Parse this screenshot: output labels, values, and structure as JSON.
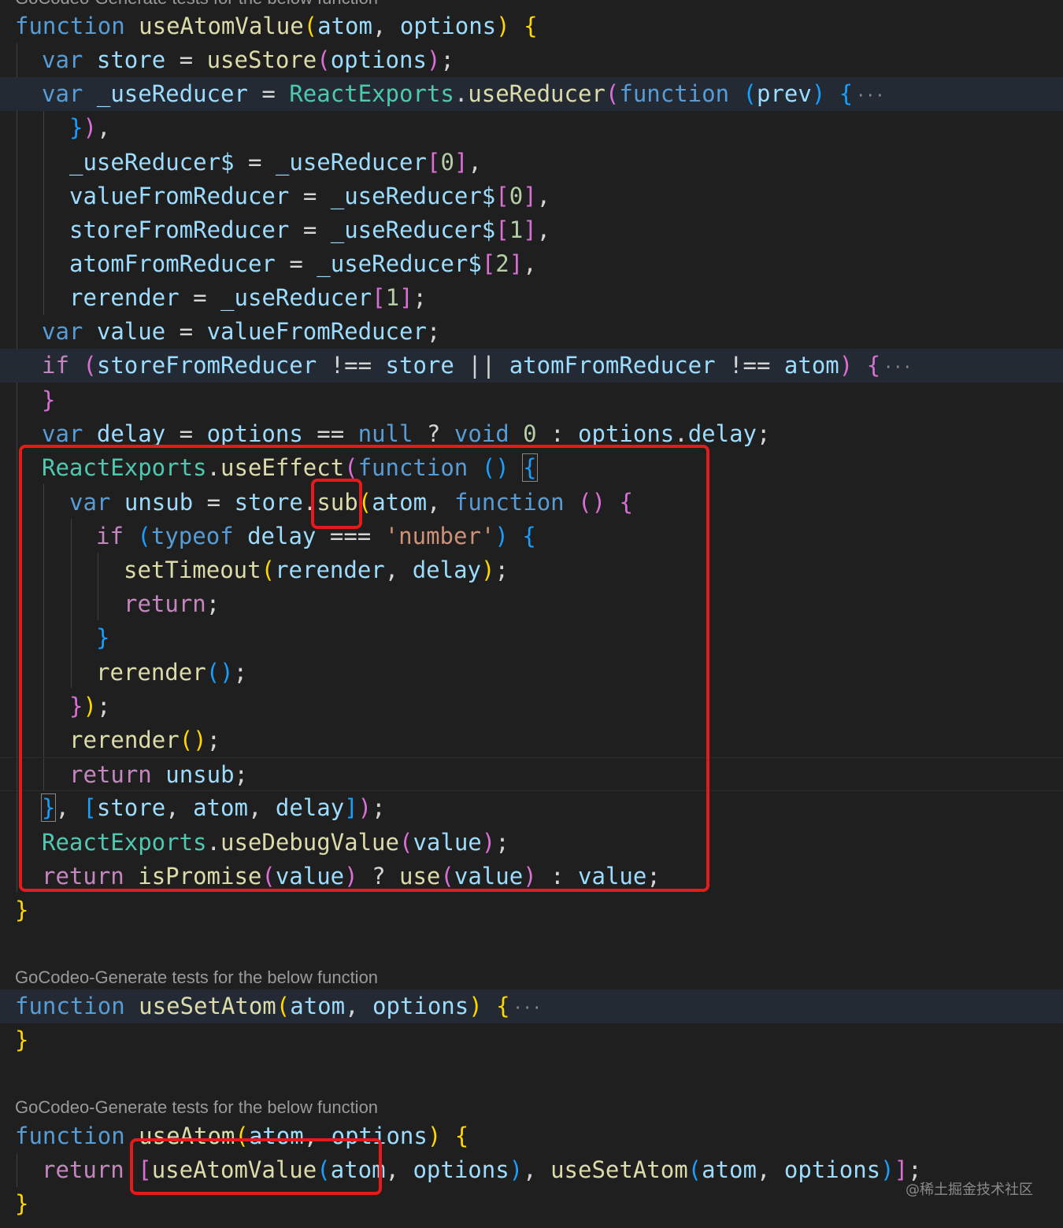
{
  "code_lens": {
    "top_partial": "GoCodeo-Generate tests for the below function",
    "use_set_atom": "GoCodeo-Generate tests for the below function",
    "use_atom": "GoCodeo-Generate tests for the below function"
  },
  "code": {
    "l1": [
      "function",
      " ",
      "useAtomValue",
      "(",
      "atom",
      ", ",
      "options",
      ")",
      " ",
      "{"
    ],
    "l2": [
      "var",
      " ",
      "store",
      " = ",
      "useStore",
      "(",
      "options",
      ")",
      ";"
    ],
    "l3": [
      "var",
      " ",
      "_useReducer",
      " = ",
      "ReactExports",
      ".",
      "useReducer",
      "(",
      "function",
      " ",
      "(",
      "prev",
      ")",
      " ",
      "{",
      "···"
    ],
    "l4": [
      "}",
      ")",
      ","
    ],
    "l5": [
      "_useReducer$",
      " = ",
      "_useReducer",
      "[",
      "0",
      "]",
      ","
    ],
    "l6": [
      "valueFromReducer",
      " = ",
      "_useReducer$",
      "[",
      "0",
      "]",
      ","
    ],
    "l7": [
      "storeFromReducer",
      " = ",
      "_useReducer$",
      "[",
      "1",
      "]",
      ","
    ],
    "l8": [
      "atomFromReducer",
      " = ",
      "_useReducer$",
      "[",
      "2",
      "]",
      ","
    ],
    "l9": [
      "rerender",
      " = ",
      "_useReducer",
      "[",
      "1",
      "]",
      ";"
    ],
    "l10": [
      "var",
      " ",
      "value",
      " = ",
      "valueFromReducer",
      ";"
    ],
    "l11": [
      "if",
      " ",
      "(",
      "storeFromReducer",
      " !== ",
      "store",
      " || ",
      "atomFromReducer",
      " !== ",
      "atom",
      ")",
      " ",
      "{",
      "···"
    ],
    "l12": [
      "}"
    ],
    "l13": [
      "var",
      " ",
      "delay",
      " = ",
      "options",
      " == ",
      "null",
      " ? ",
      "void",
      " ",
      "0",
      " : ",
      "options",
      ".",
      "delay",
      ";"
    ],
    "l14": [
      "ReactExports",
      ".",
      "useEffect",
      "(",
      "function",
      " ",
      "(",
      ")",
      " ",
      "{"
    ],
    "l15": [
      "var",
      " ",
      "unsub",
      " = ",
      "store",
      ".",
      "sub",
      "(",
      "atom",
      ", ",
      "function",
      " ",
      "(",
      ")",
      " ",
      "{"
    ],
    "l16": [
      "if",
      " ",
      "(",
      "typeof",
      " ",
      "delay",
      " === ",
      "'number'",
      ")",
      " ",
      "{"
    ],
    "l17": [
      "setTimeout",
      "(",
      "rerender",
      ", ",
      "delay",
      ")",
      ";"
    ],
    "l18": [
      "return",
      ";"
    ],
    "l19": [
      "}"
    ],
    "l20": [
      "rerender",
      "(",
      ")",
      ";"
    ],
    "l21": [
      "}",
      ")",
      ";"
    ],
    "l22": [
      "rerender",
      "(",
      ")",
      ";"
    ],
    "l23": [
      "return",
      " ",
      "unsub",
      ";"
    ],
    "l24": [
      "}",
      ", ",
      "[",
      "store",
      ", ",
      "atom",
      ", ",
      "delay",
      "]",
      ")",
      ";"
    ],
    "l25": [
      "ReactExports",
      ".",
      "useDebugValue",
      "(",
      "value",
      ")",
      ";"
    ],
    "l26": [
      "return",
      " ",
      "isPromise",
      "(",
      "value",
      ")",
      " ? ",
      "use",
      "(",
      "value",
      ")",
      " : ",
      "value",
      ";"
    ],
    "l27": [
      "}"
    ],
    "l28": [
      "function",
      " ",
      "useSetAtom",
      "(",
      "atom",
      ", ",
      "options",
      ")",
      " ",
      "{",
      "···"
    ],
    "l29": [
      "}"
    ],
    "l30": [
      "function",
      " ",
      "useAtom",
      "(",
      "atom",
      ", ",
      "options",
      ")",
      " ",
      "{"
    ],
    "l31": [
      "return",
      " ",
      "[",
      "useAtomValue",
      "(",
      "atom",
      ", ",
      "options",
      ")",
      ", ",
      "useSetAtom",
      "(",
      "atom",
      ", ",
      "options",
      ")",
      "]",
      ";"
    ],
    "l32": [
      "}"
    ]
  },
  "watermark": "@稀土掘金技术社区",
  "colors": {
    "background": "#1f1f1f",
    "keyword": "#569cd6",
    "control": "#c586c0",
    "function": "#dcdcaa",
    "variable": "#9cdcfe",
    "type": "#4ec9b0",
    "string": "#ce9178",
    "number": "#b5cea8",
    "highlight_box": "#e51a1a"
  }
}
